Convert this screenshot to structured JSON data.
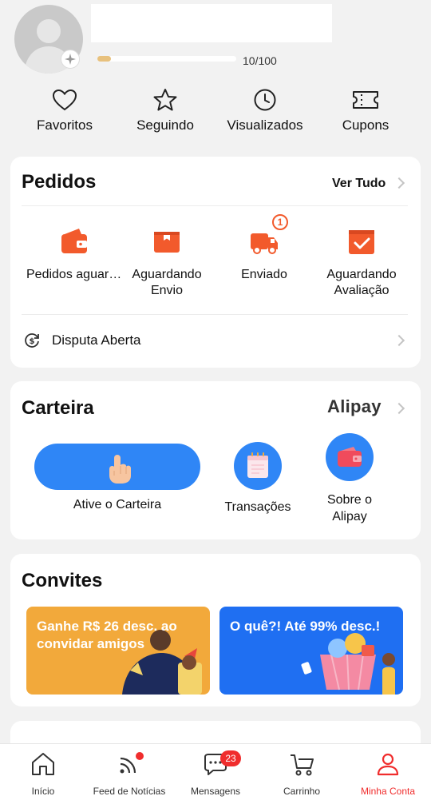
{
  "profile": {
    "progress_text": "10/100",
    "progress_fraction": 0.1
  },
  "shortcuts": [
    {
      "label": "Favoritos",
      "icon": "heart-icon"
    },
    {
      "label": "Seguindo",
      "icon": "star-icon"
    },
    {
      "label": "Visualizados",
      "icon": "clock-icon"
    },
    {
      "label": "Cupons",
      "icon": "ticket-icon"
    }
  ],
  "orders": {
    "title": "Pedidos",
    "see_all": "Ver Tudo",
    "items": [
      {
        "label": "Pedidos aguardando pagamento",
        "icon": "wallet-icon"
      },
      {
        "label": "Aguardando Envio",
        "icon": "box-icon"
      },
      {
        "label": "Enviado",
        "icon": "truck-icon",
        "badge": "1"
      },
      {
        "label": "Aguardando Avaliação",
        "icon": "review-icon"
      }
    ],
    "dispute_label": "Disputa Aberta"
  },
  "wallet": {
    "title": "Carteira",
    "brand": "Alipay",
    "activate_label": "Ative o Carteira",
    "transactions_label": "Transações",
    "about_label": "Sobre o Alipay"
  },
  "invites": {
    "title": "Convites",
    "promo1": "Ganhe R$ 26 desc. ao convidar amigos",
    "promo2": "O quê?! Até 99% desc.!"
  },
  "nav": {
    "home": "Início",
    "feed": "Feed de Notícias",
    "messages": "Mensagens",
    "messages_badge": "23",
    "cart": "Carrinho",
    "account": "Minha Conta"
  },
  "colors": {
    "accent": "#f25a2c",
    "blue": "#2f86f6",
    "active_nav": "#f02d2d",
    "promo_orange": "#f2a93b",
    "promo_blue": "#1f6ff2"
  }
}
